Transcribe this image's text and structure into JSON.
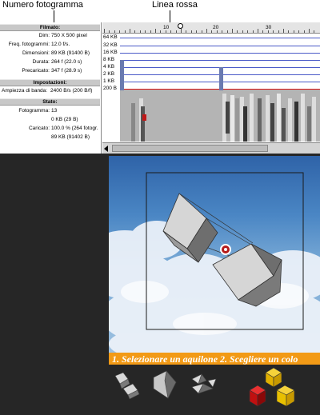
{
  "callouts": {
    "frame_number": "Numero fotogramma",
    "red_line": "Linea rossa"
  },
  "stats": {
    "movie_header": "Filmato:",
    "dim_label": "Dim:",
    "dim_value": "750 X 500 pixel",
    "fps_label": "Freq. fotogrammi:",
    "fps_value": "12.0 f/s.",
    "size_label": "Dimensioni:",
    "size_value": "89 KB (91400 B)",
    "duration_label": "Durata:",
    "duration_value": "264 f (22.0 s)",
    "preload_label": "Precaricato:",
    "preload_value": "347 f (28.9 s)",
    "settings_header": "Impostazioni:",
    "bandwidth_label": "Ampiezza di banda:",
    "bandwidth_value": "2400 B/s (200 B/f)",
    "state_header": "Stato:",
    "frame_label": "Fotogramma:",
    "frame_value": "13",
    "frame_size_value": "0 KB (29 B)",
    "loaded_label": "Caricato:",
    "loaded_value": "100.0 % (264 fotogr.",
    "loaded_bytes_value": "89 KB (91402 B)"
  },
  "timeline": {
    "ruler_numbers": [
      "10",
      "20",
      "30"
    ],
    "kb_labels": [
      "64 KB",
      "32 KB",
      "16 KB",
      "8 KB",
      "4 KB",
      "2 KB",
      "1 KB",
      "200 B"
    ]
  },
  "movie": {
    "banner_text": "1. Selezionare un aquilone     2. Scegliere un colo"
  },
  "colors": {
    "red_line": "#d81010",
    "kb_lines": "#4a5ac8",
    "banner": "#f29a16",
    "sky": "#4a86c4",
    "toy_yellow": "#f0c000",
    "toy_red": "#d01010"
  },
  "icons": [
    "kite-box-icon",
    "kite-diamond-icon",
    "kite-triangles-icon",
    "color-cubes-icon"
  ]
}
